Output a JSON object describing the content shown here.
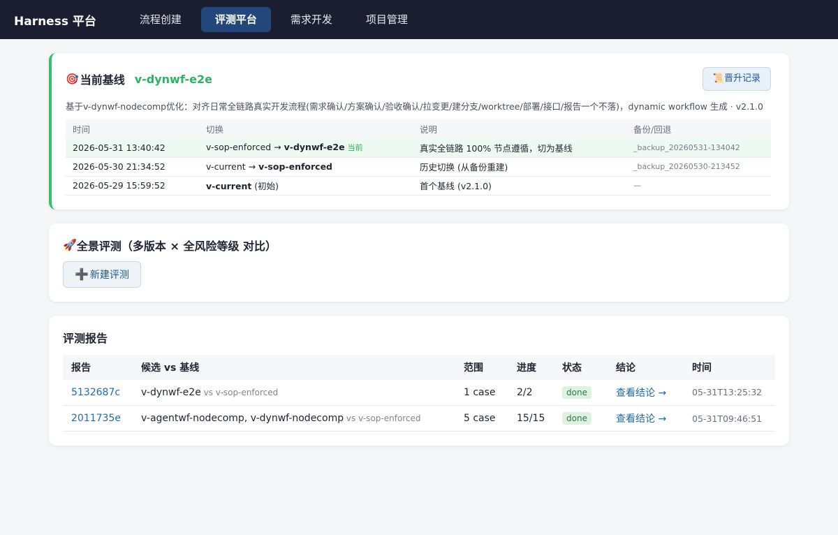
{
  "app": {
    "brand": "Harness 平台"
  },
  "nav": {
    "tabs": [
      "流程创建",
      "评测平台",
      "需求开发",
      "项目管理"
    ],
    "active_index": 1
  },
  "baseline": {
    "emoji": "🎯",
    "label": "当前基线",
    "version": "v-dynwf-e2e",
    "promote_emoji": "📜",
    "promote_label": "晋升记录",
    "description": "基于v-dynwf-nodecomp优化：对齐日常全链路真实开发流程(需求确认/方案确认/验收确认/拉变更/建分支/worktree/部署/接口/报告一个不落)，dynamic workflow 生成 · v2.1.0",
    "headers": [
      "时间",
      "切换",
      "说明",
      "备份/回退"
    ],
    "rows": [
      {
        "time": "2026-05-31 13:40:42",
        "from": "v-sop-enforced",
        "arrow": " → ",
        "to": "v-dynwf-e2e",
        "tag": "当前",
        "note": "真实全链路 100% 节点遵循，切为基线",
        "backup": "_backup_20260531-134042"
      },
      {
        "time": "2026-05-30 21:34:52",
        "from": "v-current",
        "arrow": " → ",
        "to": "v-sop-enforced",
        "tag": "",
        "note": "历史切换 (从备份重建)",
        "backup": "_backup_20260530-213452"
      },
      {
        "time": "2026-05-29 15:59:52",
        "from": "",
        "arrow": "",
        "to": "v-current",
        "suffix": " (初始)",
        "tag": "",
        "note": "首个基线 (v2.1.0)",
        "backup": "—"
      }
    ]
  },
  "panorama": {
    "emoji": "🚀",
    "title": "全景评测（多版本 × 全风险等级 对比）",
    "new_plus": "➕",
    "new_label": "新建评测"
  },
  "reports": {
    "title": "评测报告",
    "headers": [
      "报告",
      "候选 vs 基线",
      "范围",
      "进度",
      "状态",
      "结论",
      "时间"
    ],
    "rows": [
      {
        "id": "5132687c",
        "candidate": "v-dynwf-e2e",
        "vs": " vs v-sop-enforced",
        "scope": "1 case",
        "progress": "2/2",
        "status": "done",
        "conclusion": "查看结论 →",
        "time": "05-31T13:25:32"
      },
      {
        "id": "2011735e",
        "candidate": "v-agentwf-nodecomp, v-dynwf-nodecomp",
        "vs": " vs v-sop-enforced",
        "scope": "5 case",
        "progress": "15/15",
        "status": "done",
        "conclusion": "查看结论 →",
        "time": "05-31T09:46:51"
      }
    ]
  }
}
